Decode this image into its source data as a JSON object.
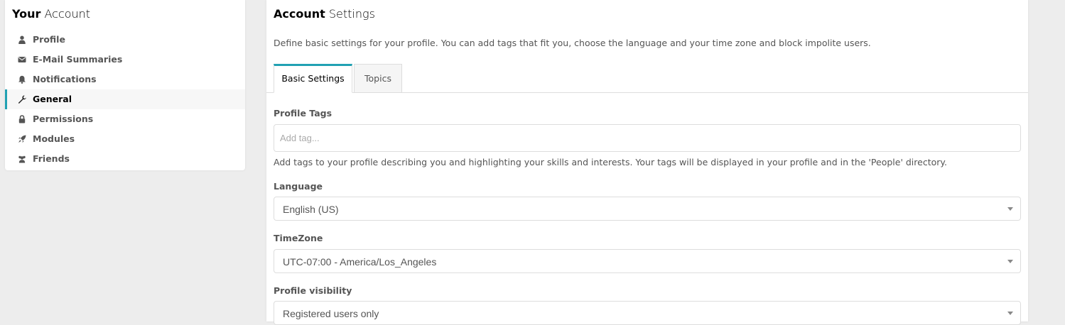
{
  "sidebar": {
    "title_bold": "Your",
    "title_rest": " Account",
    "items": [
      {
        "label": "Profile",
        "icon": "user-icon"
      },
      {
        "label": "E-Mail Summaries",
        "icon": "envelope-icon"
      },
      {
        "label": "Notifications",
        "icon": "bell-icon"
      },
      {
        "label": "General",
        "icon": "wrench-icon",
        "active": true
      },
      {
        "label": "Permissions",
        "icon": "lock-icon"
      },
      {
        "label": "Modules",
        "icon": "rocket-icon"
      },
      {
        "label": "Friends",
        "icon": "users-icon"
      }
    ]
  },
  "main": {
    "title_bold": "Account",
    "title_rest": " Settings",
    "description": "Define basic settings for your profile. You can add tags that fit you, choose the language and your time zone and block impolite users.",
    "tabs": [
      {
        "label": "Basic Settings",
        "active": true
      },
      {
        "label": "Topics",
        "active": false
      }
    ],
    "profile_tags": {
      "label": "Profile Tags",
      "placeholder": "Add tag...",
      "help": "Add tags to your profile describing you and highlighting your skills and interests. Your tags will be displayed in your profile and in the 'People' directory."
    },
    "language": {
      "label": "Language",
      "value": "English (US)"
    },
    "timezone": {
      "label": "TimeZone",
      "value": "UTC-07:00 - America/Los_Angeles"
    },
    "visibility": {
      "label": "Profile visibility",
      "value": "Registered users only"
    }
  },
  "colors": {
    "accent": "#21a1b3",
    "background": "#ededed"
  }
}
